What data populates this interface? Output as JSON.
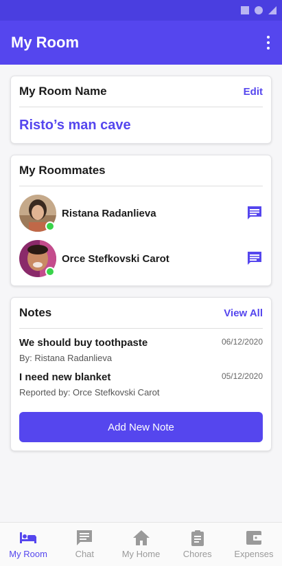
{
  "app_bar": {
    "title": "My Room"
  },
  "room_name_card": {
    "title": "My Room Name",
    "edit_label": "Edit",
    "room_name": "Risto’s man cave"
  },
  "roommates_card": {
    "title": "My Roommates",
    "roommates": [
      {
        "name": "Ristana Radanlieva",
        "status": "online"
      },
      {
        "name": "Orce Stefkovski Carot",
        "status": "online"
      }
    ]
  },
  "notes_card": {
    "title": "Notes",
    "view_all_label": "View All",
    "notes": [
      {
        "title": "We should buy toothpaste",
        "date": "06/12/2020",
        "byline": "By: Ristana Radanlieva"
      },
      {
        "title": "I need new blanket",
        "date": "05/12/2020",
        "byline": "Reported by: Orce Stefkovski Carot"
      }
    ],
    "add_button_label": "Add New Note"
  },
  "bottom_nav": {
    "items": [
      {
        "label": "My Room",
        "icon": "bed-icon",
        "active": true
      },
      {
        "label": "Chat",
        "icon": "chat-icon",
        "active": false
      },
      {
        "label": "My Home",
        "icon": "home-icon",
        "active": false
      },
      {
        "label": "Chores",
        "icon": "clipboard-icon",
        "active": false
      },
      {
        "label": "Expenses",
        "icon": "wallet-icon",
        "active": false
      }
    ]
  },
  "colors": {
    "primary": "#5546ee",
    "status_bar": "#4a3ee0",
    "online": "#39d34a",
    "inactive_nav": "#9a9a9a"
  }
}
